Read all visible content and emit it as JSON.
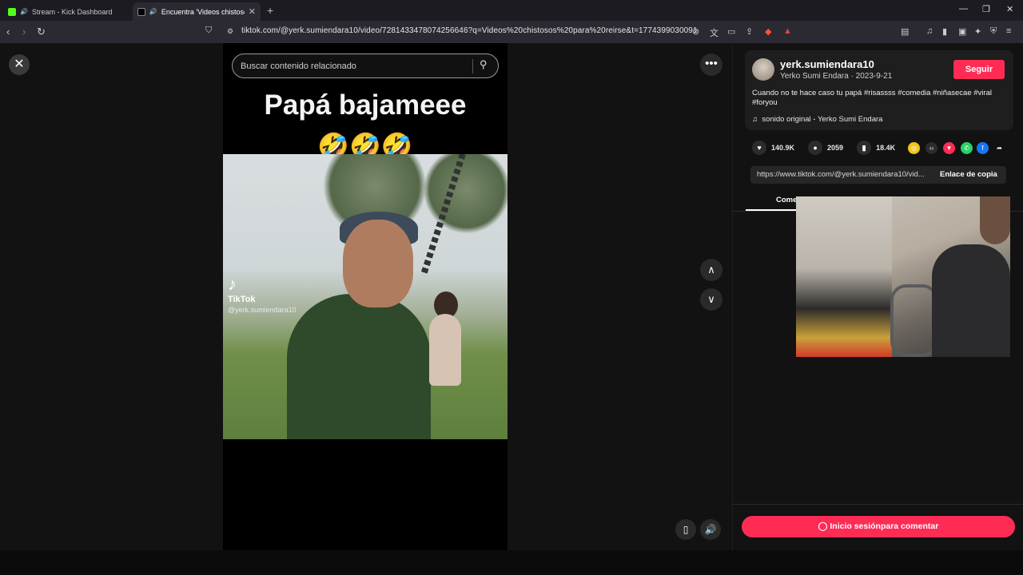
{
  "browser": {
    "tabs": [
      {
        "title": "Stream - Kick Dashboard",
        "active": false
      },
      {
        "title": "Encuentra 'Videos chistosos p",
        "active": true
      }
    ],
    "url": "tiktok.com/@yerk.sumiendara10/video/7281433478074256646?q=Videos%20chistosos%20para%20reirse&t=1774399030091"
  },
  "video": {
    "search_placeholder": "Buscar contenido relacionado",
    "caption": "Papá bajameee",
    "emojis": "🤣🤣🤣",
    "watermark_brand": "TikTok",
    "watermark_user": "@yerk.sumiendara10"
  },
  "post": {
    "username": "yerk.sumiendara10",
    "subline": "Yerko Sumi Endara · 2023-9-21",
    "follow_label": "Seguir",
    "description": "Cuando no te hace caso tu papá #risassss #comedia #niñasecae #viral #foryou",
    "music": "sonido original - Yerko Sumi Endara",
    "likes": "140.9K",
    "comments": "2059",
    "saves": "18.4K",
    "link": "https://www.tiktok.com/@yerk.sumiendara10/vid...",
    "copy_label": "Enlace de copia",
    "comments_tab": "Comentarios",
    "login_label": "Inicio sesiónpara comentar"
  },
  "colors": {
    "accent": "#fe2c55",
    "background": "#121212"
  }
}
